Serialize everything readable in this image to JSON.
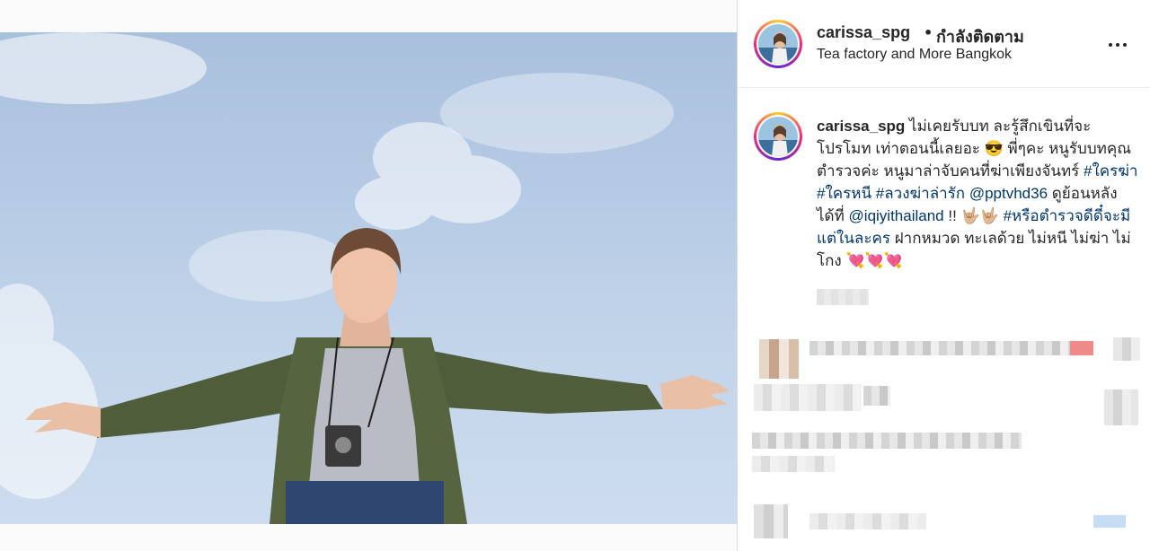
{
  "post": {
    "username": "carissa_spg",
    "separator": "•",
    "follow_status": "กำลังติดตาม",
    "location": "Tea factory and More Bangkok"
  },
  "icons": {
    "more": "more-options-icon"
  },
  "caption": {
    "username": "carissa_spg",
    "text_1": " ไม่เคยรับบท ละรู้สึกเขินที่จะโปรโมท เท่าตอนนี้เลยอะ 😎 พี่ๆคะ หนูรับบทคุณตำรวจค่ะ หนูมาล่าจับคนที่ฆ่าเพียงจันทร์ ",
    "hashtags_1": "#ใครฆ่า #ใครหนี #ลวงฆ่าล่ารัก",
    "mention_1": "@pptvhd36",
    "text_2": " ดูย้อนหลังได้ที่ ",
    "mention_2": "@iqiyithailand",
    "text_3": " !! 🤟🏼🤟🏼 ",
    "hashtag_2": "#หรือตำรวจดีดี๋จะมีแต่ในละคร",
    "text_4": " ฝากหมวด ทะเลด้วย ไม่หนี ไม่ฆ่า ไม่โกง 💘💘💘"
  },
  "colors": {
    "link": "#00376b",
    "text": "#262626",
    "border": "#dbdbdb"
  }
}
